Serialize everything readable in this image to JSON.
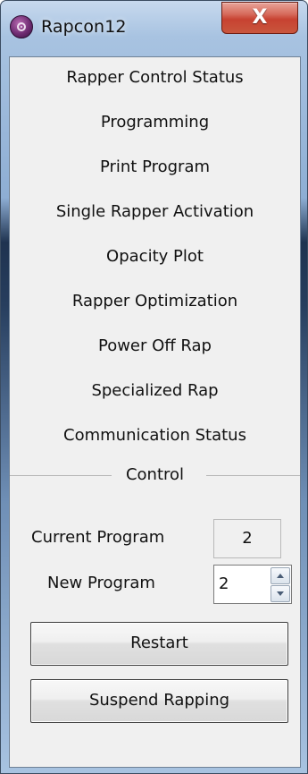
{
  "window": {
    "title": "Rapcon12",
    "close_glyph": "X",
    "icon": "app-disc-icon"
  },
  "menu": {
    "items": [
      {
        "label": "Rapper Control Status"
      },
      {
        "label": "Programming"
      },
      {
        "label": "Print Program"
      },
      {
        "label": "Single Rapper Activation"
      },
      {
        "label": "Opacity Plot"
      },
      {
        "label": "Rapper Optimization"
      },
      {
        "label": "Power Off Rap"
      },
      {
        "label": "Specialized Rap"
      },
      {
        "label": "Communication Status"
      }
    ]
  },
  "control": {
    "group_title": "Control",
    "current_program_label": "Current Program",
    "current_program_value": "2",
    "new_program_label": "New Program",
    "new_program_value": "2",
    "restart_label": "Restart",
    "suspend_label": "Suspend Rapping"
  },
  "colors": {
    "client_bg": "#f0f0f0",
    "close_button": "#c74231",
    "app_icon": "#6f2c72"
  }
}
